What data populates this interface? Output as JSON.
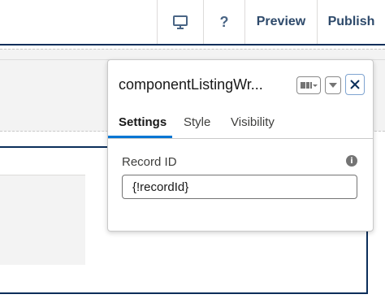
{
  "toolbar": {
    "preview_label": "Preview",
    "publish_label": "Publish",
    "help_label": "?",
    "desktop_icon": "desktop-icon"
  },
  "panel": {
    "title": "componentListingWr...",
    "tabs": [
      {
        "label": "Settings",
        "active": true
      },
      {
        "label": "Style",
        "active": false
      },
      {
        "label": "Visibility",
        "active": false
      }
    ],
    "field": {
      "label": "Record ID",
      "value": "{!recordId}",
      "info_icon": "info-icon"
    },
    "icons": [
      "component-variation-icon",
      "chevron-down-icon",
      "close-icon"
    ]
  },
  "colors": {
    "accent": "#0176d3",
    "navy": "#0b2e5a",
    "toolbar_text": "#2e4a6b"
  }
}
